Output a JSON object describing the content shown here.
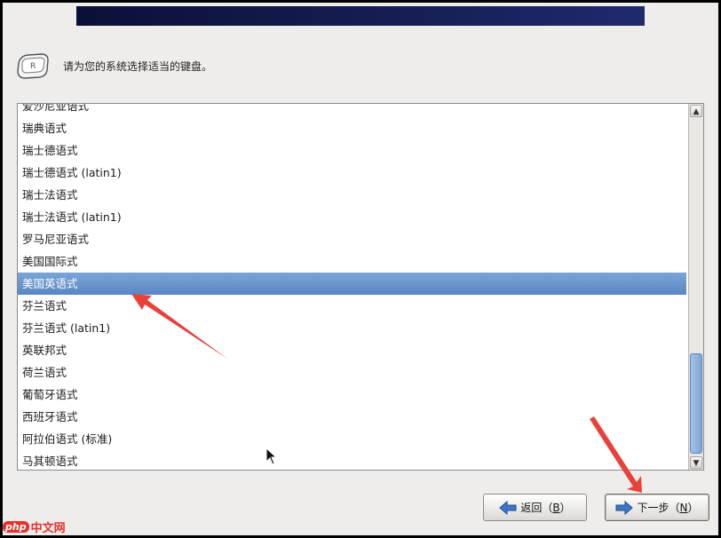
{
  "header": {
    "icon": "keyboard-icon",
    "prompt": "请为您的系统选择适当的键盘。"
  },
  "keyboard_list": {
    "items": [
      "爱沙尼亚语式",
      "瑞典语式",
      "瑞士德语式",
      "瑞士德语式 (latin1)",
      "瑞士法语式",
      "瑞士法语式 (latin1)",
      "罗马尼亚语式",
      "美国国际式",
      "美国英语式",
      "芬兰语式",
      "芬兰语式 (latin1)",
      "英联邦式",
      "荷兰语式",
      "葡萄牙语式",
      "西班牙语式",
      "阿拉伯语式 (标准)",
      "马其顿语式"
    ],
    "selected_index": 8
  },
  "buttons": {
    "back": {
      "label": "返回（",
      "mnemonic": "B",
      "suffix": "）"
    },
    "next": {
      "label": "下一步（",
      "mnemonic": "N",
      "suffix": "）"
    }
  },
  "colors": {
    "selection": "#6a95cc",
    "annotation_arrow": "#e8413a",
    "banner": "#111748"
  },
  "watermark": {
    "prefix": "php",
    "text": "中文网"
  }
}
